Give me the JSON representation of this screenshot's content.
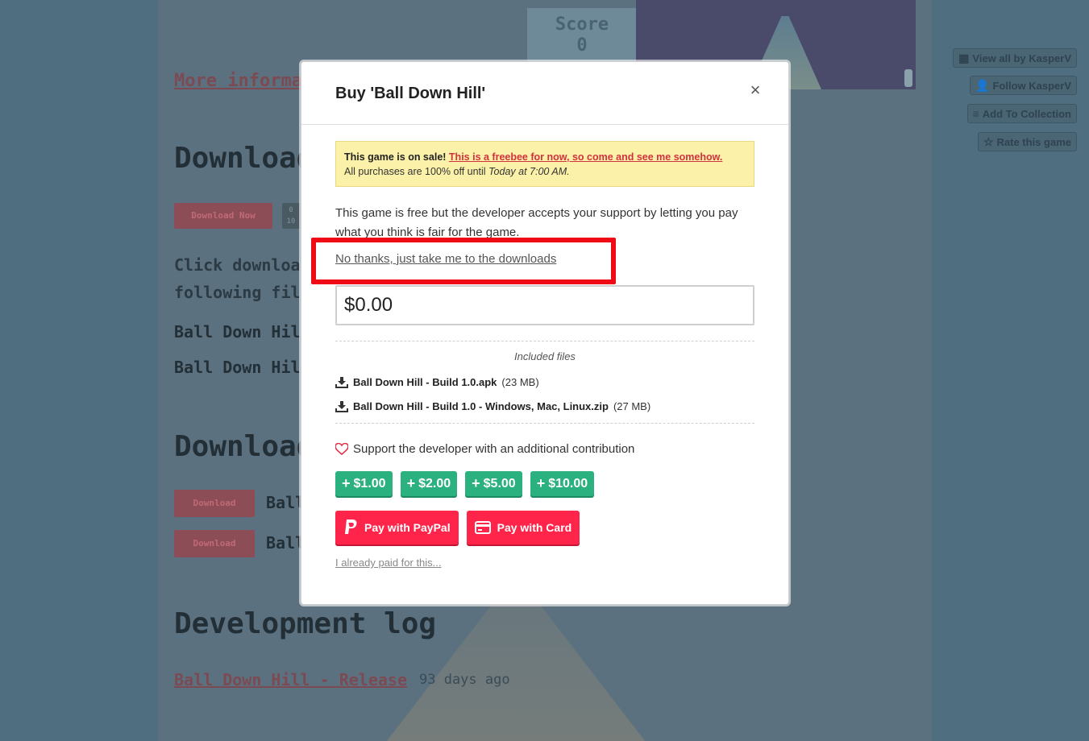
{
  "background_page": {
    "score_label": "Score",
    "score_value": "0",
    "more_info_link": "More information",
    "download_heading_1": "Download",
    "download_now_btn": "Download Now",
    "download_small_btn_line1": "0",
    "download_small_btn_line2": "10",
    "click_download_text_line1": "Click download",
    "click_download_text_line2": "following files",
    "file_line_1": "Ball Down Hill",
    "file_line_2": "Ball Down Hill",
    "download_heading_2": "Download",
    "download_btn": "Download",
    "ball_label": "Ball",
    "devlog_heading": "Development log",
    "devlog_link": "Ball Down Hill - Release",
    "devlog_age": "93 days ago"
  },
  "sidebar": {
    "view_all": "View all by KasperV",
    "follow": "Follow KasperV",
    "add_collection": "Add To Collection",
    "rate": "Rate this game"
  },
  "modal": {
    "title": "Buy 'Ball Down Hill'",
    "close_symbol": "×",
    "sale": {
      "lead": "This game is on sale!",
      "link_text": "This is a freebee for now, so come and see me somehow.",
      "line2_prefix": "All purchases are 100% off until",
      "line2_time": "Today at 7:00 AM."
    },
    "description": "This game is free but the developer accepts your support by letting you pay what you think is fair for the game.",
    "no_thanks": "No thanks, just take me to the downloads",
    "price_value": "$0.00",
    "included_files_label": "Included files",
    "files": [
      {
        "name": "Ball Down Hill - Build 1.0.apk",
        "size": "(23 MB)"
      },
      {
        "name": "Ball Down Hill - Build 1.0 - Windows, Mac, Linux.zip",
        "size": "(27 MB)"
      }
    ],
    "support_text": "Support the developer with an additional contribution",
    "tips": [
      "$1.00",
      "$2.00",
      "$5.00",
      "$10.00"
    ],
    "pay_paypal": "Pay with PayPal",
    "pay_card": "Pay with Card",
    "already_paid": "I already paid for this..."
  },
  "colors": {
    "overlay": "#4f6f80",
    "tip_green": "#2bb07f",
    "pay_red": "#ff2449",
    "highlight_red": "#ef0b16",
    "sale_yellow": "#fcf1a9"
  }
}
